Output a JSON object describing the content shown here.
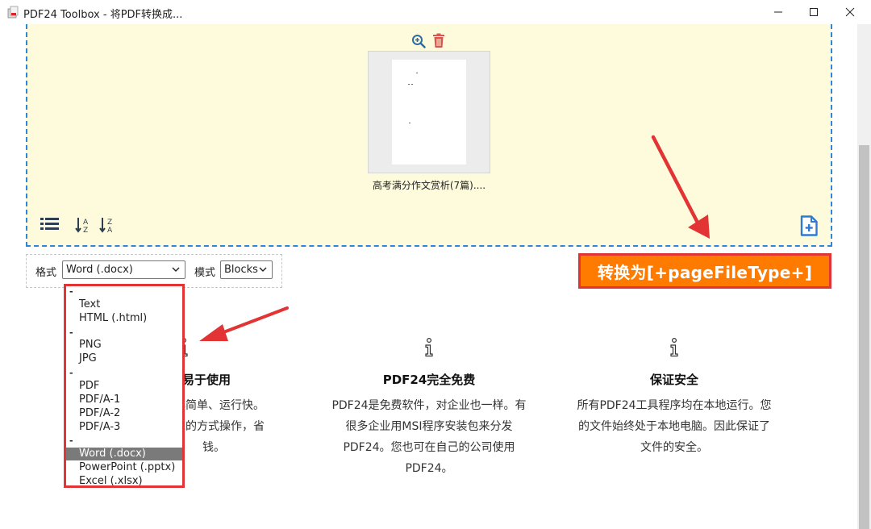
{
  "window": {
    "title": "PDF24 Toolbox - 将PDF转换成...",
    "minimize_icon": "minimize-icon",
    "maximize_icon": "maximize-icon",
    "close_icon": "close-icon"
  },
  "dropzone": {
    "file_name": "高考满分作文赏析(7篇)....",
    "toolbar_icons": [
      "list-icon",
      "sort-az-icon",
      "sort-za-icon",
      "add-file-icon",
      "zoom-in-icon",
      "trash-icon"
    ]
  },
  "options": {
    "format_label": "格式",
    "format_value": "Word (.docx)",
    "mode_label": "模式",
    "mode_value": "Blocks"
  },
  "convert_button": {
    "label": "转换为[+pageFileType+]"
  },
  "dropdown": {
    "groups": [
      {
        "sep": "-",
        "items": [
          "Text",
          "HTML (.html)"
        ]
      },
      {
        "sep": "-",
        "items": [
          "PNG",
          "JPG"
        ]
      },
      {
        "sep": "-",
        "items": [
          "PDF",
          "PDF/A-1",
          "PDF/A-2",
          "PDF/A-3"
        ]
      },
      {
        "sep": "-",
        "items": [
          "Word (.docx)",
          "PowerPoint (.pptx)",
          "Excel (.xlsx)"
        ]
      }
    ],
    "selected": "Word (.docx)"
  },
  "features": [
    {
      "title": "易于使用",
      "lines": [
        "工具简单、运行快。",
        "直觉的方式操作，省",
        "钱。"
      ]
    },
    {
      "title": "PDF24完全免费",
      "lines": [
        "PDF24是免费软件，对企业也一样。有",
        "很多企业用MSI程序安装包来分发",
        "PDF24。您也可在自己的公司使用",
        "PDF24。"
      ]
    },
    {
      "title": "保证安全",
      "lines": [
        "所有PDF24工具程序均在本地运行。您",
        "的文件始终处于本地电脑。因此保证了",
        "文件的安全。"
      ]
    }
  ],
  "colors": {
    "dropzone_bg": "#fdfbdc",
    "dropzone_border": "#2f86d6",
    "convert_bg": "#ff7b00",
    "annotation_red": "#e23434"
  }
}
